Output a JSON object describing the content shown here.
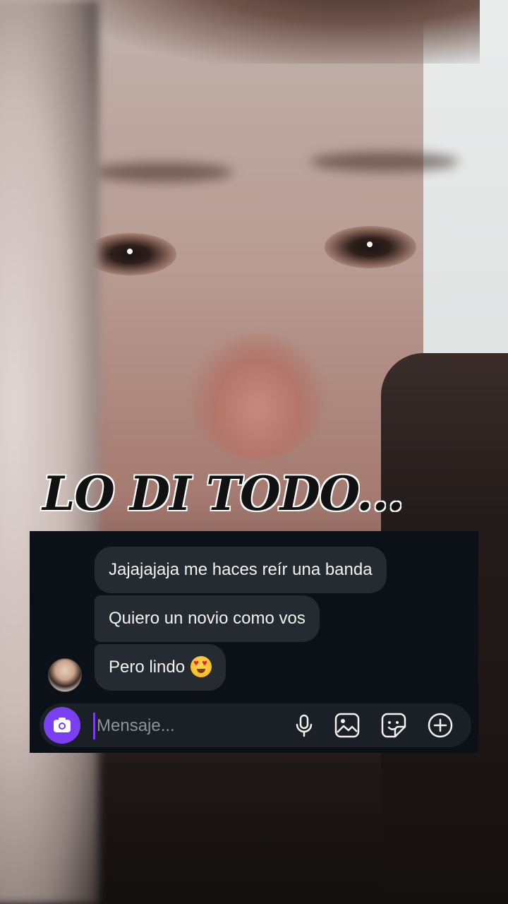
{
  "caption": "LO DI TODO...",
  "chat": {
    "messages": [
      {
        "text": "Jajajajaja me haces reír una banda"
      },
      {
        "text": "Quiero un novio como vos"
      },
      {
        "text": "Pero lindo",
        "emoji": "smiling-face-with-heart-eyes"
      }
    ],
    "composer": {
      "placeholder": "Mensaje...",
      "icons": [
        "camera-icon",
        "microphone-icon",
        "gallery-icon",
        "sticker-icon",
        "plus-icon"
      ]
    }
  },
  "colors": {
    "accent": "#7b3ff2",
    "panel": "#0c1117",
    "bubble": "#262a31"
  }
}
